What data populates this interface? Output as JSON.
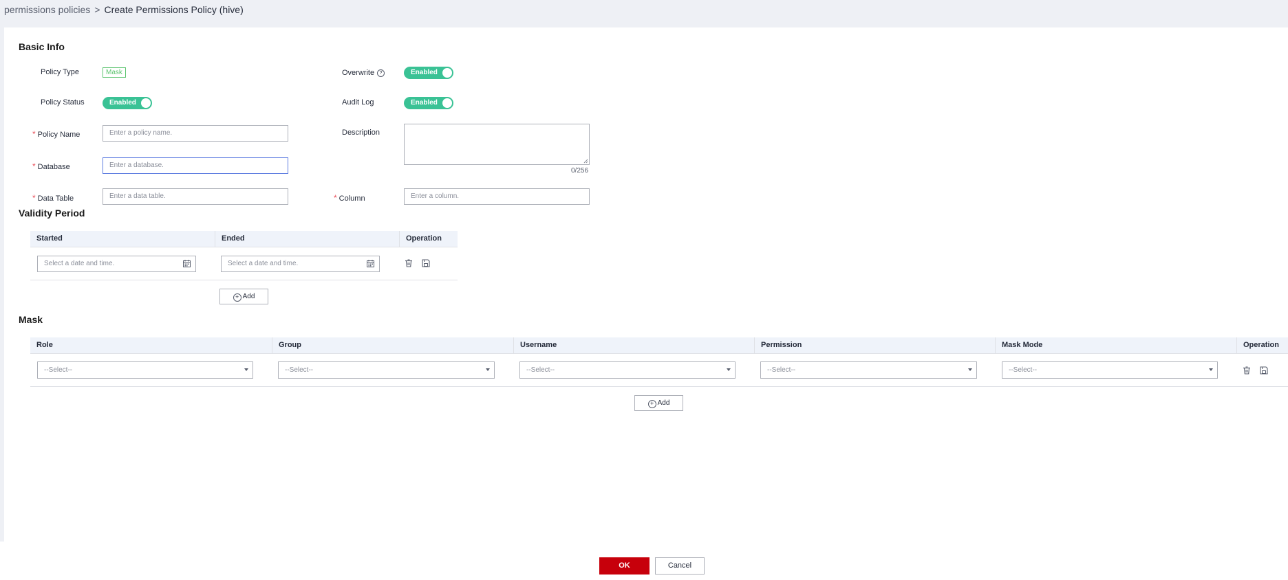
{
  "breadcrumb": {
    "parent": "permissions policies",
    "separator": ">",
    "current": "Create Permissions Policy",
    "context": "(hive)"
  },
  "basic_info": {
    "title": "Basic Info",
    "policy_type_label": "Policy Type",
    "policy_type_value": "Mask",
    "overwrite_label": "Overwrite",
    "overwrite_help": "?",
    "overwrite_switch": "Enabled",
    "policy_status_label": "Policy Status",
    "policy_status_switch": "Enabled",
    "audit_log_label": "Audit Log",
    "audit_log_switch": "Enabled",
    "required_mark": "*",
    "policy_name_label": "Policy Name",
    "policy_name_placeholder": "Enter a policy name.",
    "description_label": "Description",
    "description_counter": "0/256",
    "database_label": "Database",
    "database_placeholder": "Enter a database.",
    "data_table_label": "Data Table",
    "data_table_placeholder": "Enter a data table.",
    "column_label": "Column",
    "column_placeholder": "Enter a column."
  },
  "validity": {
    "title": "Validity Period",
    "headers": [
      "Started",
      "Ended",
      "Operation"
    ],
    "started_placeholder": "Select a date and time.",
    "ended_placeholder": "Select a date and time.",
    "add_label": "Add"
  },
  "mask": {
    "title": "Mask",
    "headers": [
      "Role",
      "Group",
      "Username",
      "Permission",
      "Mask Mode",
      "Operation"
    ],
    "select_placeholder": "--Select--",
    "add_label": "Add"
  },
  "footer": {
    "ok_label": "OK",
    "cancel_label": "Cancel"
  },
  "colors": {
    "accent": "#3ac295",
    "primary_button": "#c7000b",
    "tag": "#5cc46f",
    "focus_border": "#5e7ce0"
  },
  "icons": [
    "help-icon",
    "calendar-icon",
    "delete-icon",
    "save-icon",
    "add-circle-icon",
    "dropdown-caret-icon"
  ]
}
